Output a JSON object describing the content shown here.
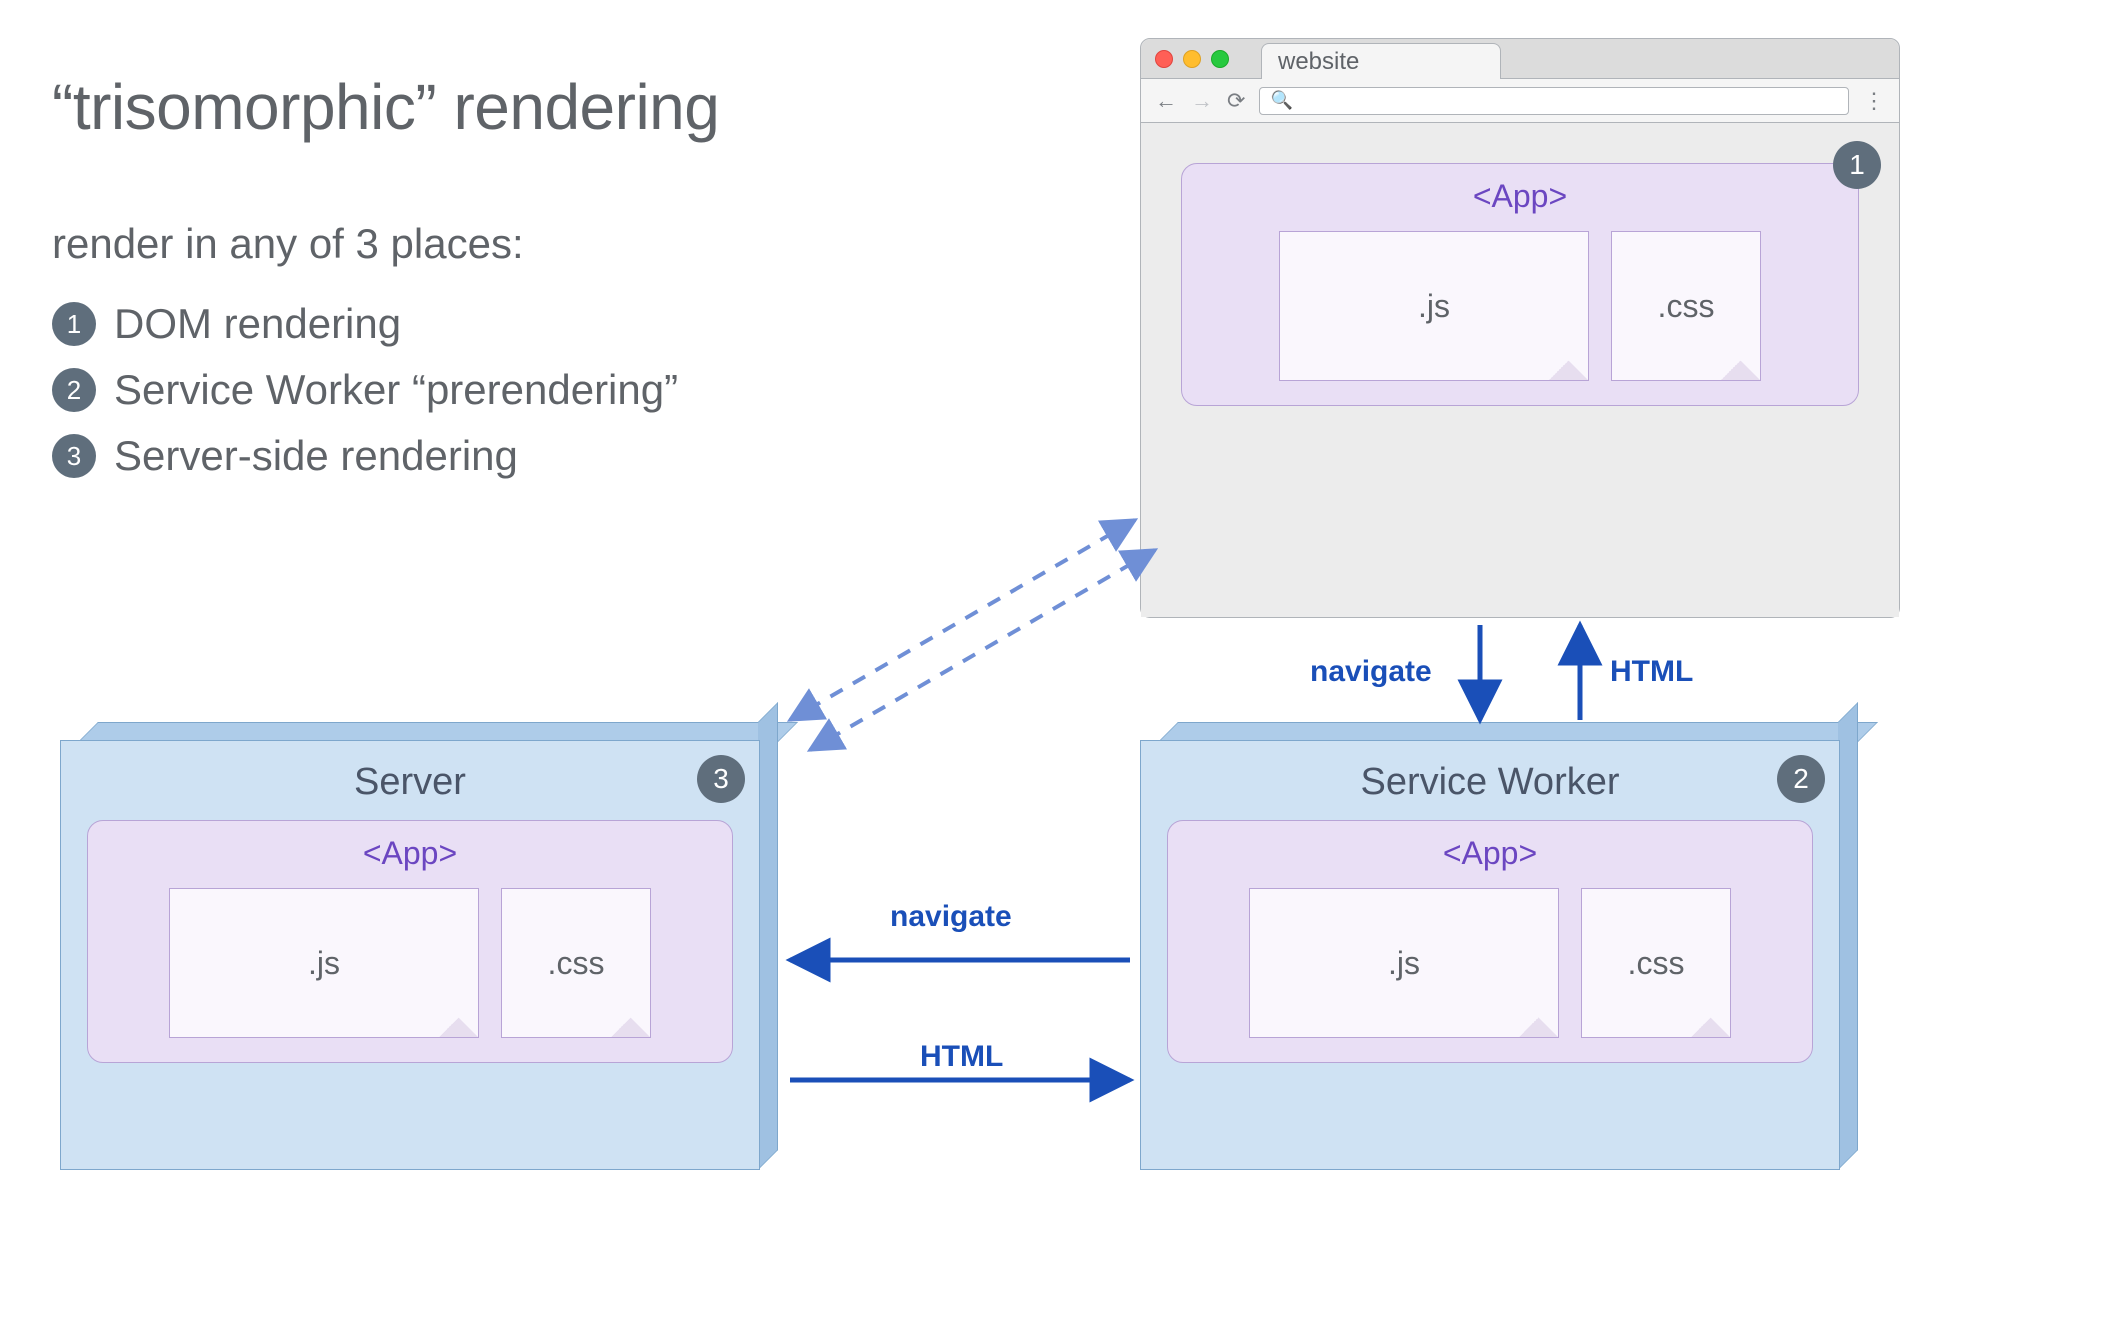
{
  "title": "“trisomorphic” rendering",
  "subtitle": "render in any of 3 places:",
  "list": [
    {
      "n": "1",
      "label": "DOM rendering"
    },
    {
      "n": "2",
      "label": "Service Worker “prerendering”"
    },
    {
      "n": "3",
      "label": "Server-side rendering"
    }
  ],
  "browser": {
    "tab_label": "website",
    "badge": "1",
    "app_label": "<App>",
    "file_js": ".js",
    "file_css": ".css",
    "search_placeholder": "🔍"
  },
  "server_panel": {
    "title": "Server",
    "badge": "3",
    "app_label": "<App>",
    "file_js": ".js",
    "file_css": ".css"
  },
  "sw_panel": {
    "title": "Service Worker",
    "badge": "2",
    "app_label": "<App>",
    "file_js": ".js",
    "file_css": ".css"
  },
  "arrows": {
    "browser_sw_down": "navigate",
    "browser_sw_up": "HTML",
    "sw_server_left": "navigate",
    "sw_server_right": "HTML"
  },
  "colors": {
    "badge_bg": "#5f6e7c",
    "panel_bg": "#cfe2f3",
    "app_bg": "#e9dff5",
    "app_border": "#b8a4d6",
    "arrow": "#1a4fb8"
  }
}
